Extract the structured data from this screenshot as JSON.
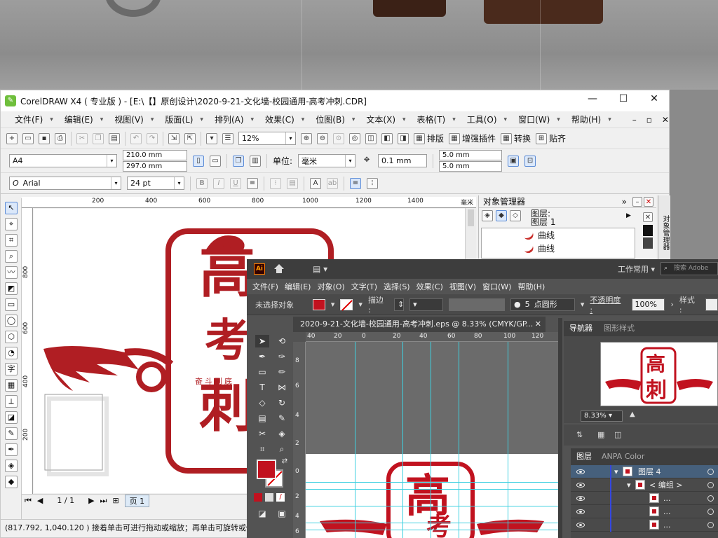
{
  "coreldraw": {
    "title": "CorelDRAW X4 ( 专业版 ) - [E:\\【】原创设计\\2020-9-21-文化墙-校园通用-高考冲刺.CDR]",
    "menu": [
      "文件(F)",
      "编辑(E)",
      "视图(V)",
      "版面(L)",
      "排列(A)",
      "效果(C)",
      "位图(B)",
      "文本(X)",
      "表格(T)",
      "工具(O)",
      "窗口(W)",
      "帮助(H)"
    ],
    "zoom": "12%",
    "toolbar_text_buttons": [
      "排版",
      "增强插件",
      "转换",
      "贴齐"
    ],
    "page_size": "A4",
    "width": "210.0 mm",
    "height": "297.0 mm",
    "unit_label": "单位:",
    "unit_value": "毫米",
    "nudge": "0.1 mm",
    "dup_x": "5.0 mm",
    "dup_y": "5.0 mm",
    "font_name": "Arial",
    "font_size": "24 pt",
    "ruler_h": [
      "200",
      "400",
      "600",
      "800",
      "1000",
      "1200",
      "1400"
    ],
    "ruler_unit": "毫米",
    "ruler_v": [
      "800",
      "600",
      "400",
      "200"
    ],
    "page_indicator": "1 / 1",
    "page_tab": "页 1",
    "status": "(817.792, 1,040.120 ) 接着单击可进行拖动或缩放；再单击可旋转或倾",
    "object_manager": {
      "title": "对象管理器",
      "layer_label": "图层:",
      "layer_name": "图层 1",
      "items": [
        "曲线",
        "曲线"
      ],
      "side_tab": "对象管理器"
    }
  },
  "illustrator": {
    "logo": "Ai",
    "workspace": "工作常用",
    "search_placeholder": "搜索 Adobe",
    "menu": [
      "文件(F)",
      "编辑(E)",
      "对象(O)",
      "文字(T)",
      "选择(S)",
      "效果(C)",
      "视图(V)",
      "窗口(W)",
      "帮助(H)"
    ],
    "control": {
      "no_selection": "未选择对象",
      "stroke_label": "描边 :",
      "brush_size": "5",
      "brush_name": "点圆形",
      "opacity_label": "不透明度 :",
      "opacity_value": "100%",
      "style_label": "样式 :"
    },
    "doc_tab": "2020-9-21-文化墙-校园通用-高考冲刺.eps @ 8.33% (CMYK/GP...",
    "ruler_h": [
      "40",
      "20",
      "0",
      "20",
      "40",
      "60",
      "80",
      "100",
      "120"
    ],
    "ruler_v": [
      "8",
      "6",
      "4",
      "2",
      "0",
      "2",
      "4",
      "6"
    ],
    "navigator": {
      "tabs": [
        "导航器",
        "图形样式"
      ],
      "zoom": "8.33%"
    },
    "layers": {
      "tabs": [
        "图层",
        "ANPA Color"
      ],
      "rows": [
        "图层 4",
        "< 编组 >",
        "...",
        "...",
        "...",
        "..."
      ]
    },
    "colors": {
      "accent_red": "#c1121f",
      "layer_bar": "#3447e2",
      "selection": "#46607c"
    }
  },
  "artwork": {
    "main_char_top": "高",
    "main_char_mid": "考",
    "main_char_bottom": "刺",
    "slogan": "奋斗到底",
    "color": "#b01e23"
  }
}
